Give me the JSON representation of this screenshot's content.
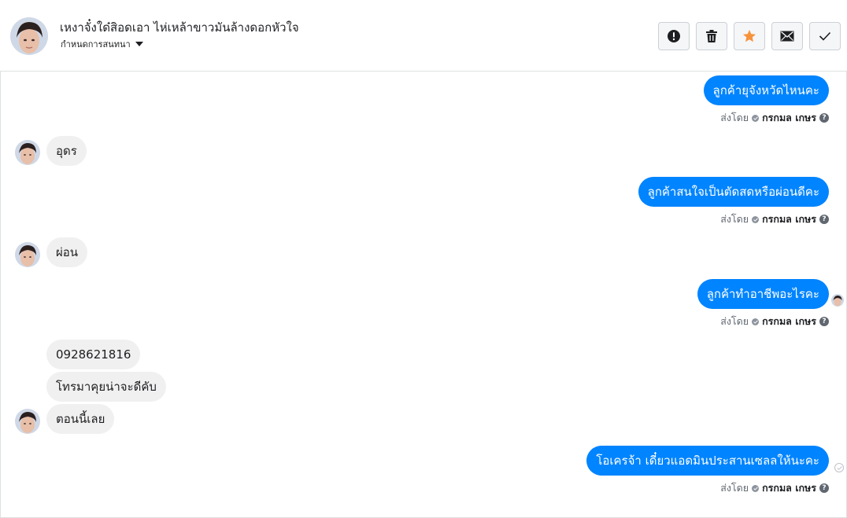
{
  "header": {
    "contact_name": "เหงาจั๋งใด๋สิอดเอา ไห่เหล้าขาวมันล้างดอกหัวใจ",
    "subtitle": "กำหนดการสนทนา",
    "actions": [
      {
        "name": "mark-spam-button",
        "icon": "exclamation-icon"
      },
      {
        "name": "delete-button",
        "icon": "trash-icon"
      },
      {
        "name": "star-button",
        "icon": "star-icon",
        "color": "#f7923b"
      },
      {
        "name": "mark-unread-button",
        "icon": "envelope-icon"
      },
      {
        "name": "mark-done-button",
        "icon": "checkmark-icon"
      }
    ]
  },
  "messages": {
    "m1": {
      "direction": "outgoing",
      "text": "ลูกค้ายุจังหวัดไหนคะ"
    },
    "m2": {
      "direction": "incoming",
      "text": "อุดร"
    },
    "m3": {
      "direction": "outgoing",
      "text": "ลูกค้าสนใจเป็นตัดสดหรือผ่อนดีคะ"
    },
    "m4": {
      "direction": "incoming",
      "text": "ผ่อน"
    },
    "m5": {
      "direction": "outgoing",
      "text": "ลูกค้าทำอาชีพอะไรคะ"
    },
    "m6": {
      "direction": "incoming",
      "text": "0928621816"
    },
    "m7": {
      "direction": "incoming",
      "text": "โทรมาคุยน่าจะดีคับ"
    },
    "m8": {
      "direction": "incoming",
      "text": "ตอนนี้เลย"
    },
    "m9": {
      "direction": "outgoing",
      "text": "โอเครจ้า เดี๋ยวแอดมินประสานเซลลให้นะคะ"
    }
  },
  "sent_by": {
    "label": "ส่งโดย",
    "agent": "กรกมล เกษร",
    "help": "?"
  },
  "colors": {
    "outgoing_bubble": "#0084ff",
    "incoming_bubble": "#f1f0f0",
    "star": "#f7923b"
  }
}
